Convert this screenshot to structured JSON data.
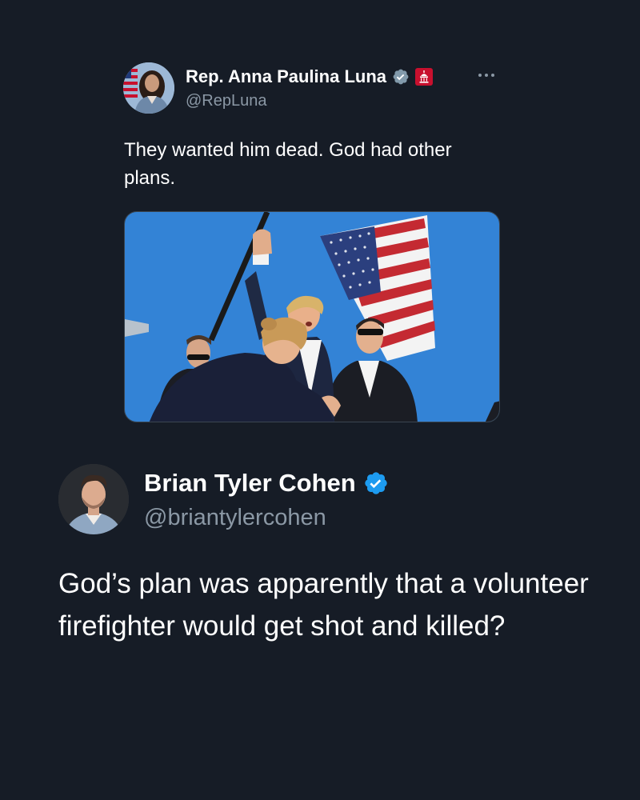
{
  "quoted_tweet": {
    "display_name": "Rep. Anna Paulina Luna",
    "handle": "@RepLuna",
    "text": "They wanted him dead. God had other plans.",
    "verified_badge_color": "#829aab",
    "affiliation_badge_color": "#c8102e",
    "avatar_icon": "profile-photo",
    "more_icon": "ellipsis-icon",
    "media": "photo"
  },
  "reply_tweet": {
    "display_name": "Brian Tyler Cohen",
    "handle": "@briantylercohen",
    "text": "God’s plan was apparently that a volunteer firefighter would get shot and killed?",
    "verified_badge_color": "#1d9bf0",
    "avatar_icon": "profile-photo"
  },
  "colors": {
    "background": "#161c26",
    "primary_text": "#ffffff",
    "secondary_text": "#8b98a5"
  }
}
